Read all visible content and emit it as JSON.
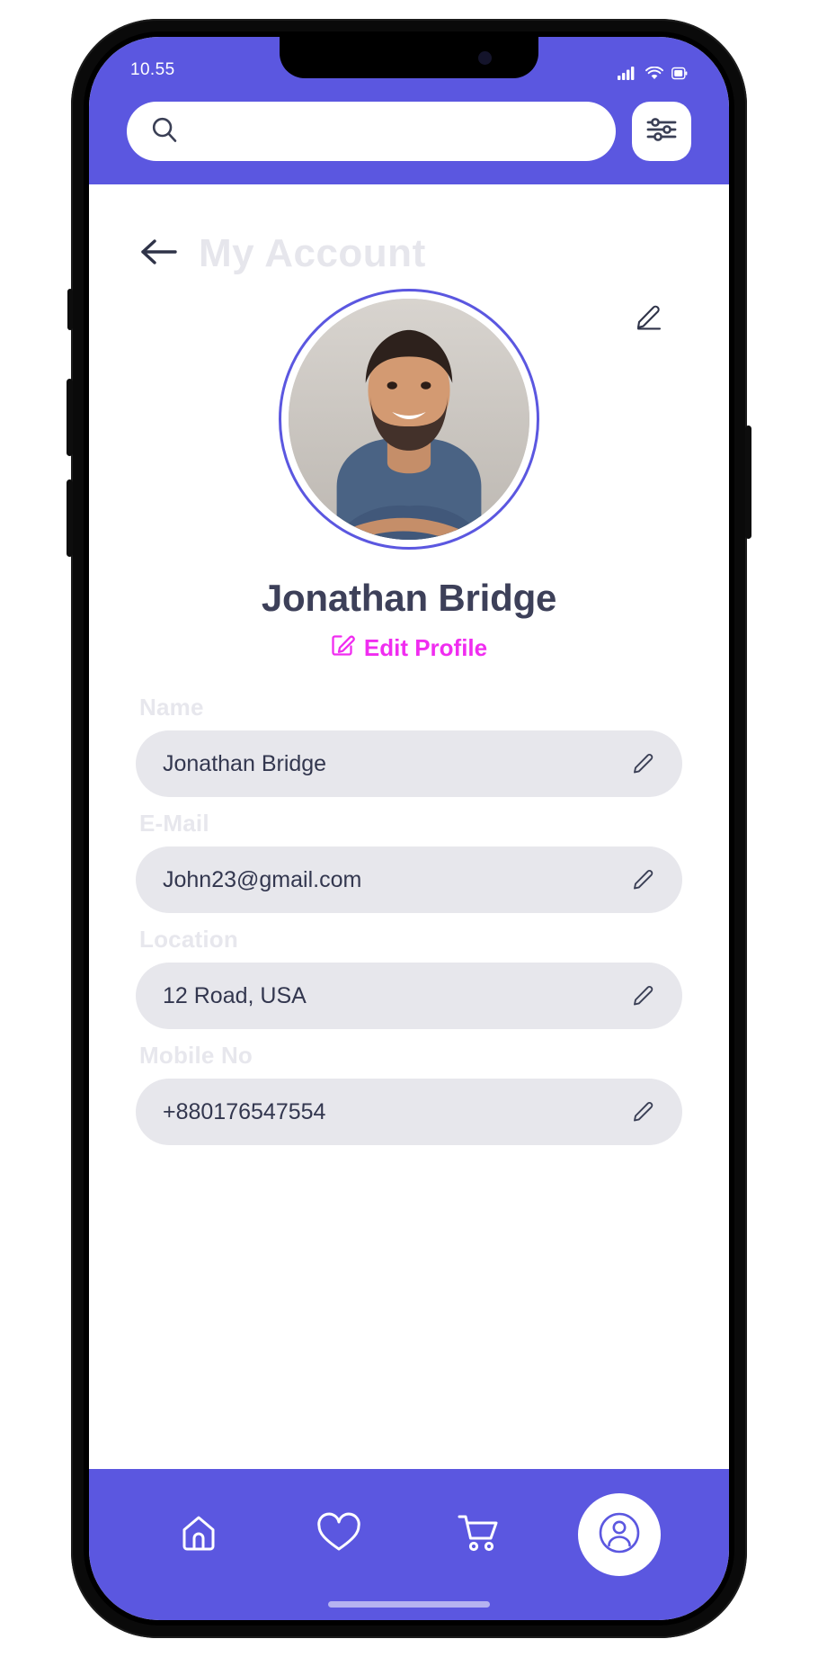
{
  "statusbar": {
    "time": "10.55",
    "icons": [
      "cellular-signal-icon",
      "wifi-icon",
      "battery-icon"
    ]
  },
  "header": {
    "search": {
      "icon": "search-icon",
      "value": "",
      "placeholder": ""
    },
    "filter_button": {
      "icon": "filter-sliders-icon",
      "label": "Filter"
    },
    "background_color": "#5b57e0"
  },
  "page": {
    "back_icon": "back-arrow-icon",
    "title": "My Account",
    "title_color": "#e6e6ec"
  },
  "profile": {
    "avatar": {
      "icon": "user-photo-avatar",
      "ring_color": "#5b57e0"
    },
    "avatar_edit_icon": "pencil-edit-icon",
    "name": "Jonathan Bridge",
    "edit_profile": {
      "icon": "edit-square-icon",
      "label": "Edit Profile",
      "color": "#f02df0"
    }
  },
  "form": {
    "fields": [
      {
        "label": "Name",
        "value": "Jonathan Bridge",
        "edit_icon": "pencil-edit-icon"
      },
      {
        "label": "E-Mail",
        "value": "John23@gmail.com",
        "edit_icon": "pencil-edit-icon"
      },
      {
        "label": "Location",
        "value": "12 Road, USA",
        "edit_icon": "pencil-edit-icon"
      },
      {
        "label": "Mobile No",
        "value": "+880176547554",
        "edit_icon": "pencil-edit-icon"
      }
    ]
  },
  "bottom_nav": {
    "items": [
      {
        "name": "home",
        "icon": "home-icon",
        "active": false
      },
      {
        "name": "wishlist",
        "icon": "heart-icon",
        "active": false
      },
      {
        "name": "cart",
        "icon": "cart-icon",
        "active": false
      },
      {
        "name": "profile",
        "icon": "user-icon",
        "active": true
      }
    ],
    "background_color": "#5b57e0",
    "active_color": "#5b57e0",
    "inactive_color": "#ffffff"
  }
}
